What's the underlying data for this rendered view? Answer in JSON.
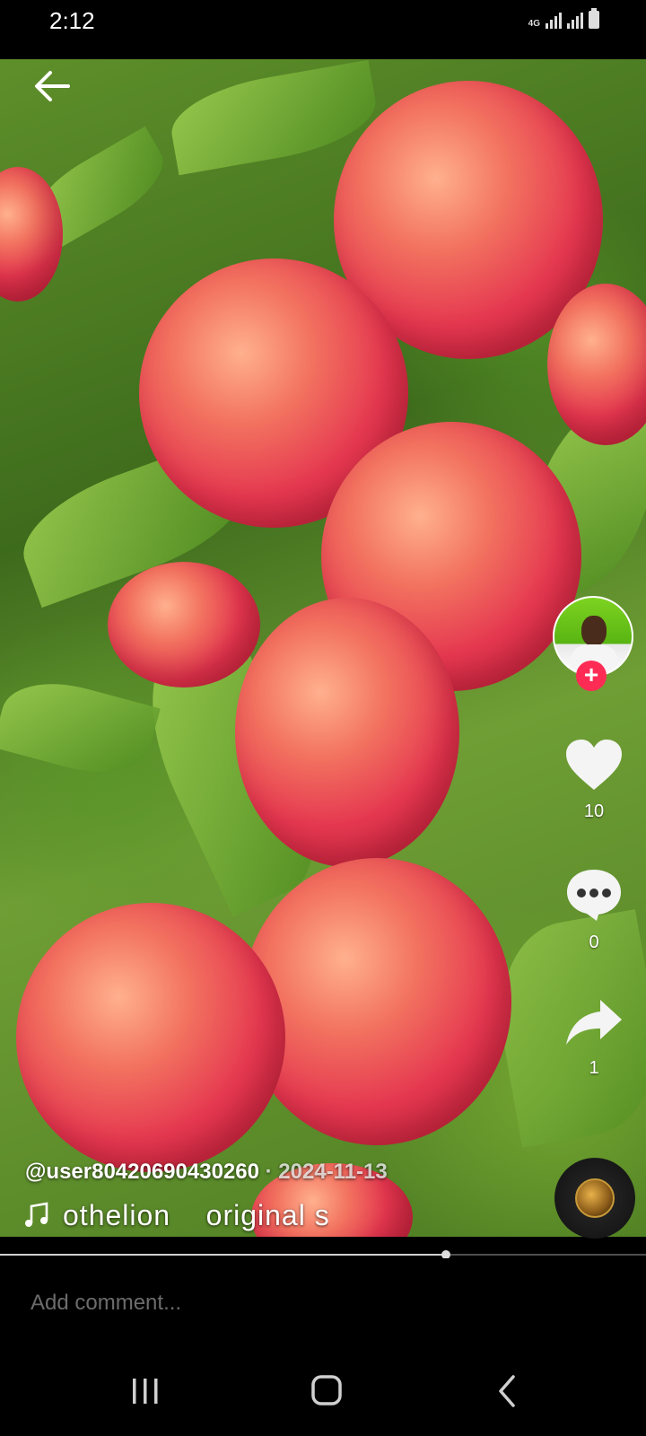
{
  "status_bar": {
    "time": "2:12",
    "network": "4G",
    "icons": [
      "signal-icon",
      "signal-icon",
      "battery-icon"
    ]
  },
  "video": {
    "progress": 0.69
  },
  "author": {
    "handle": "@user80420690430260",
    "separator": " · ",
    "date": "2024-11-13"
  },
  "music": {
    "text": "othelion    original sound",
    "icon": "music-note-icon"
  },
  "actions": {
    "like": {
      "icon": "heart-icon",
      "count": "10"
    },
    "comment": {
      "icon": "comment-icon",
      "count": "0"
    },
    "share": {
      "icon": "share-icon",
      "count": "1"
    },
    "follow": {
      "icon": "plus-icon",
      "label": "+"
    }
  },
  "comment_bar": {
    "placeholder": "Add comment..."
  },
  "colors": {
    "accent": "#fe2c55",
    "background": "#000000"
  }
}
